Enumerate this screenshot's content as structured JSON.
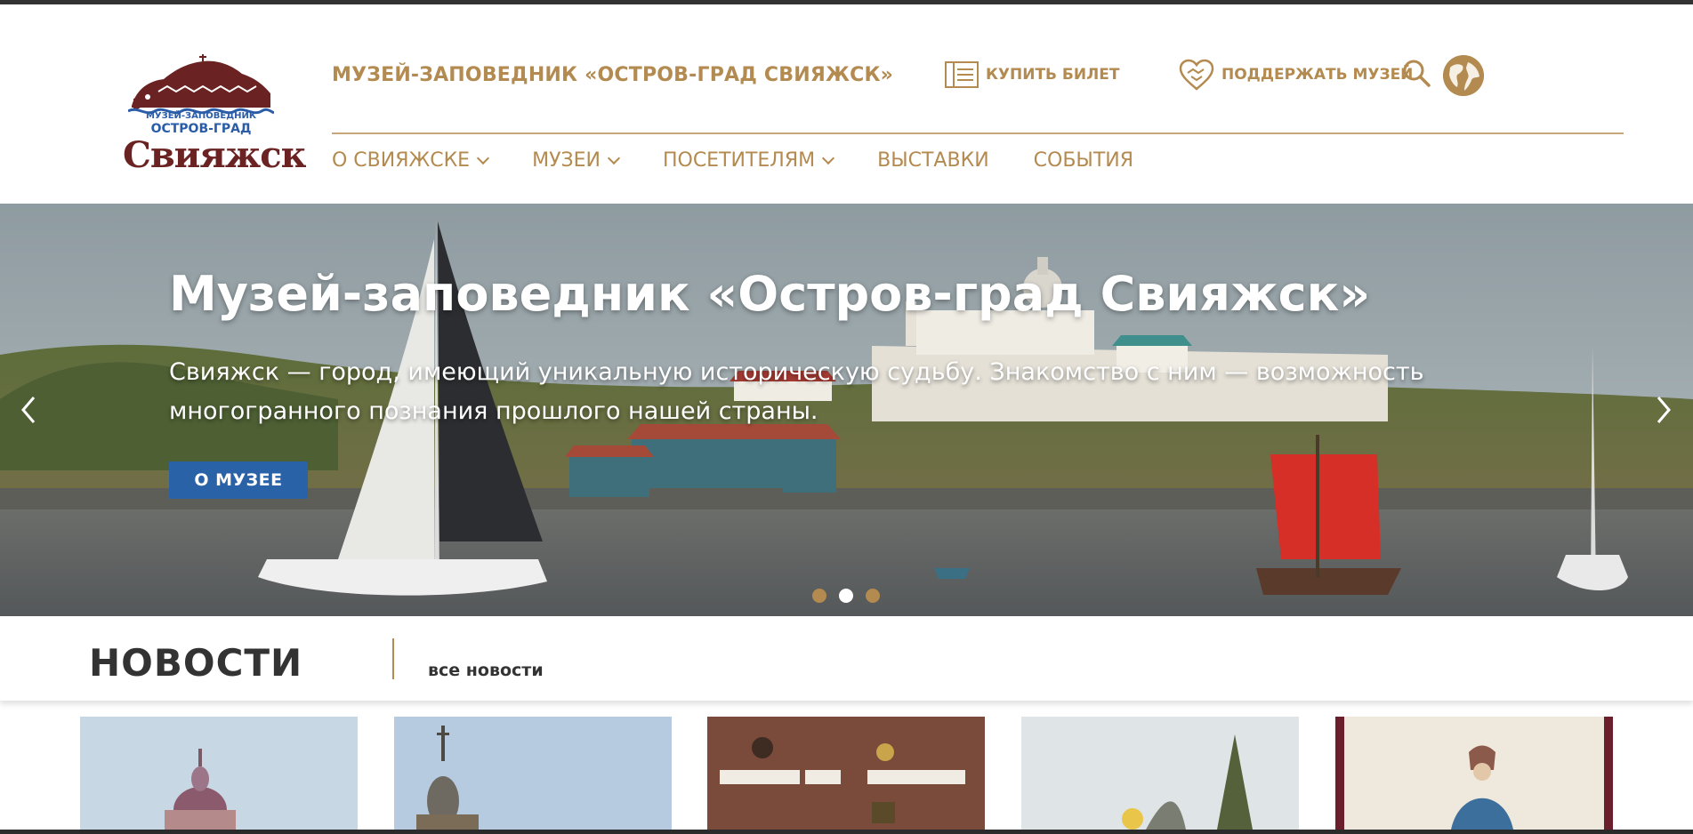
{
  "header": {
    "logo": {
      "line1": "МУЗЕЙ-ЗАПОВЕДНИК",
      "line2": "ОСТРОВ-ГРАД",
      "line3": "Свияжск"
    },
    "site_title": "МУЗЕЙ-ЗАПОВЕДНИК «ОСТРОВ-ГРАД СВИЯЖСК»",
    "buy_ticket": "КУПИТЬ БИЛЕТ",
    "support": "ПОДДЕРЖАТЬ МУЗЕЙ",
    "search_icon": "search-icon",
    "language_icon": "globe-icon"
  },
  "nav": [
    {
      "label": "О СВИЯЖСКЕ",
      "has_dropdown": true
    },
    {
      "label": "МУЗЕИ",
      "has_dropdown": true
    },
    {
      "label": "ПОСЕТИТЕЛЯМ",
      "has_dropdown": true
    },
    {
      "label": "ВЫСТАВКИ",
      "has_dropdown": false
    },
    {
      "label": "СОБЫТИЯ",
      "has_dropdown": false
    }
  ],
  "hero": {
    "title": "Музей-заповедник «Остров-град Свияжск»",
    "text": "Свияжск — город, имеющий уникальную историческую судьбу. Знакомство с ним — возможность многогранного познания прошлого нашей страны.",
    "button": "О МУЗЕЕ",
    "slides": 3,
    "active_slide": 2
  },
  "news": {
    "title": "НОВОСТИ",
    "all_link": "все новости"
  },
  "colors": {
    "accent": "#b38a4f",
    "primary_button": "#2a62a8",
    "logo_red": "#6b2222",
    "logo_blue": "#2a5ca8"
  }
}
